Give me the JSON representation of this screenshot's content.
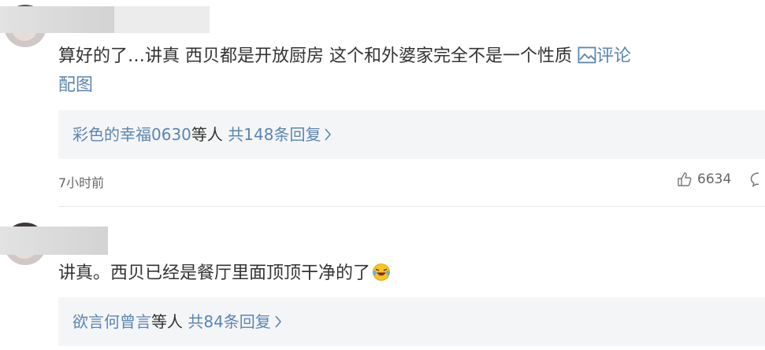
{
  "comments": [
    {
      "text": "算好的了…讲真 西贝都是开放厨房 这个和外婆家完全不是一个性质",
      "pic_link": "评论",
      "text_line2": "配图",
      "reply_names": "彩色的幸福0630",
      "reply_etc": "等人",
      "reply_count": "共148条回复",
      "time": "7小时前",
      "likes": "6634"
    },
    {
      "text": "讲真。西贝已经是餐厅里面顶顶干净的了",
      "emoji": "laughing-tears-emoji",
      "reply_names": "欲言何曾言",
      "reply_etc": "等人",
      "reply_count": "共84条回复"
    }
  ],
  "colors": {
    "link": "#5b86b0",
    "text": "#333333",
    "reply_bg": "#f4f5f7",
    "meta": "#666666"
  }
}
